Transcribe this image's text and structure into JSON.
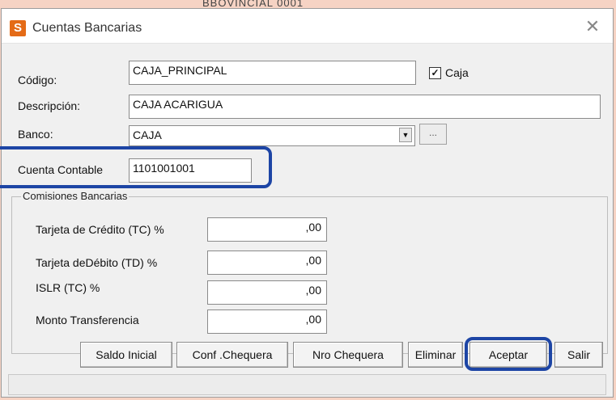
{
  "window": {
    "title": "Cuentas Bancarias",
    "background_peek_text": "BBOVINCIAL 0001"
  },
  "form": {
    "codigo_label": "Código:",
    "codigo_value": "CAJA_PRINCIPAL",
    "caja_checkbox_label": "Caja",
    "caja_checked": true,
    "descripcion_label": "Descripción:",
    "descripcion_value": "CAJA ACARIGUA",
    "banco_label": "Banco:",
    "banco_value": "CAJA",
    "banco_lookup_label": "...",
    "cuenta_contable_label": "Cuenta Contable",
    "cuenta_contable_value": "1101001001"
  },
  "comisiones": {
    "legend": "Comisiones Bancarias",
    "rows": [
      {
        "label": "Tarjeta de Crédito (TC) %",
        "value": ",00"
      },
      {
        "label": "Tarjeta deDébito (TD) %",
        "value": ",00"
      },
      {
        "label": "ISLR (TC) %",
        "value": ",00"
      },
      {
        "label": "Monto Transferencia",
        "value": ",00"
      }
    ]
  },
  "buttons": {
    "saldo_inicial": "Saldo Inicial",
    "conf_chequera": "Conf .Chequera",
    "nro_chequera": "Nro Chequera",
    "eliminar": "Eliminar",
    "aceptar": "Aceptar",
    "salir": "Salir"
  },
  "colors": {
    "highlight": "#1d45a5",
    "app_icon": "#e46b17",
    "background": "#f6d3c4"
  },
  "icons": {
    "app": "S-app-icon",
    "close": "close-icon",
    "dropdown": "chevron-down-icon",
    "checkbox": "checkmark-icon"
  }
}
